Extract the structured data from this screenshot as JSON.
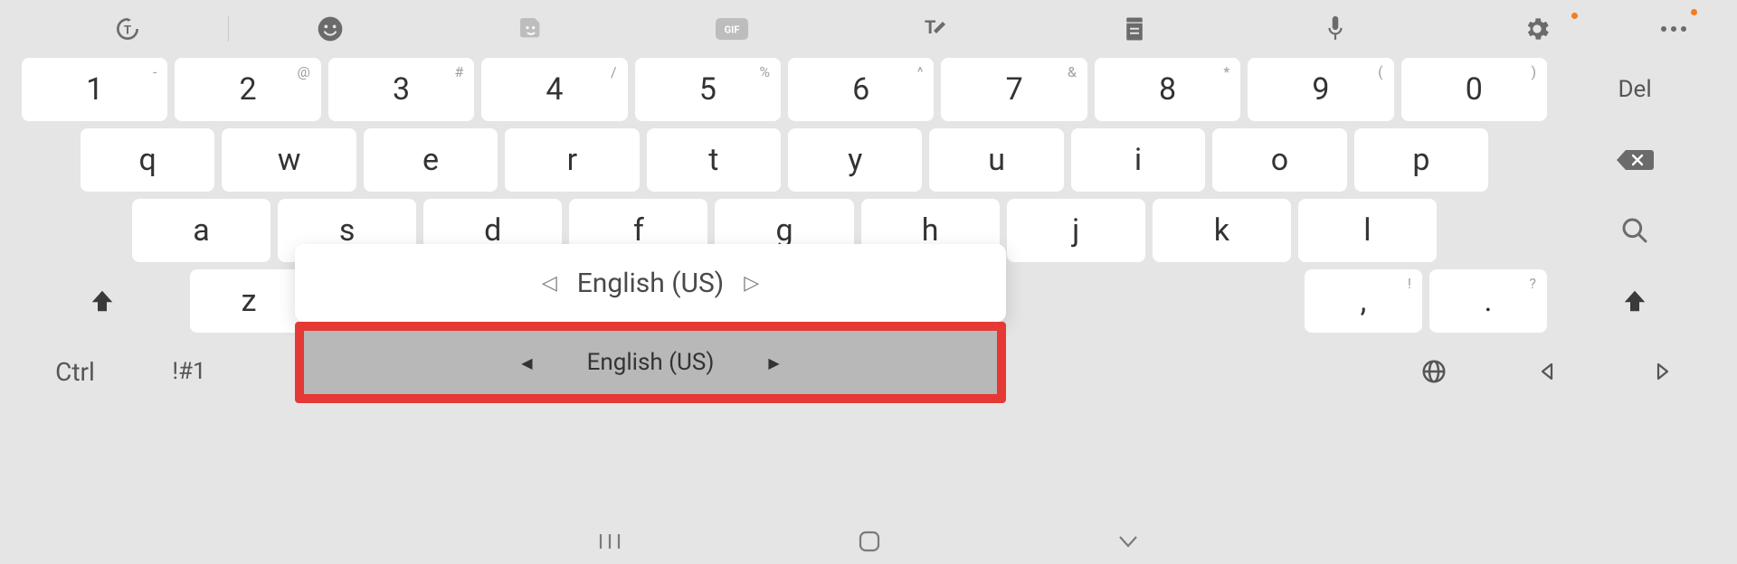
{
  "toolbar": {
    "icons": [
      "text-scan",
      "divider",
      "emoji",
      "sticker",
      "gif",
      "handwriting",
      "clipboard",
      "voice",
      "settings",
      "more"
    ]
  },
  "row_num": [
    {
      "main": "1",
      "sup": "-"
    },
    {
      "main": "2",
      "sup": "@"
    },
    {
      "main": "3",
      "sup": "#"
    },
    {
      "main": "4",
      "sup": "/"
    },
    {
      "main": "5",
      "sup": "%"
    },
    {
      "main": "6",
      "sup": "^"
    },
    {
      "main": "7",
      "sup": "&"
    },
    {
      "main": "8",
      "sup": "*"
    },
    {
      "main": "9",
      "sup": "("
    },
    {
      "main": "0",
      "sup": ")"
    }
  ],
  "del_label": "Del",
  "row_q": [
    "q",
    "w",
    "e",
    "r",
    "t",
    "y",
    "u",
    "i",
    "o",
    "p"
  ],
  "row_a": [
    "a",
    "s",
    "d",
    "f",
    "g",
    "h",
    "j",
    "k",
    "l"
  ],
  "row_z": {
    "letters": [
      "z"
    ],
    "comma": ",",
    "excl_sup": "!",
    "period": ".",
    "qmark_sup": "?"
  },
  "ctrl_label": "Ctrl",
  "sym_label": "!#1",
  "lang_popup_text": "English (US)",
  "spacebar_text": "English (US)",
  "colors": {
    "highlight": "#e53935",
    "accent": "#f57c1f"
  }
}
